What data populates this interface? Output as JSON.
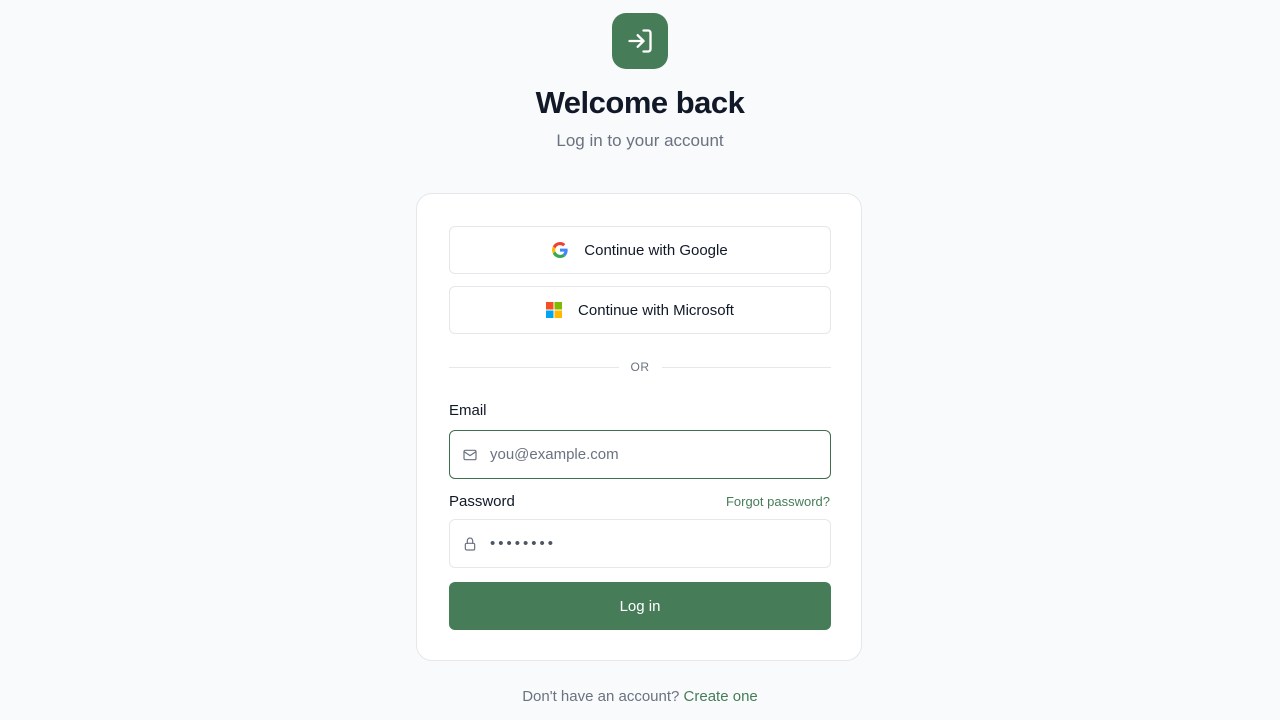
{
  "header": {
    "logo_icon": "login-arrow-icon",
    "title": "Welcome back",
    "subtitle": "Log in to your account"
  },
  "sso": {
    "google_label": "Continue with Google",
    "google_icon": "google-icon",
    "microsoft_label": "Continue with Microsoft",
    "microsoft_icon": "microsoft-icon"
  },
  "divider": {
    "text": "OR"
  },
  "form": {
    "email_label": "Email",
    "email_placeholder": "you@example.com",
    "email_value": "",
    "email_icon": "mail-icon",
    "password_label": "Password",
    "password_value": "••••••••",
    "password_icon": "lock-icon",
    "forgot_label": "Forgot password?",
    "submit_label": "Log in"
  },
  "footer": {
    "prompt": "Don't have an account?",
    "link_label": "Create one"
  },
  "colors": {
    "accent": "#467d58",
    "background": "#f8fafc",
    "card": "#ffffff",
    "border": "#e5e7eb",
    "text": "#111827",
    "muted": "#6b7280"
  }
}
